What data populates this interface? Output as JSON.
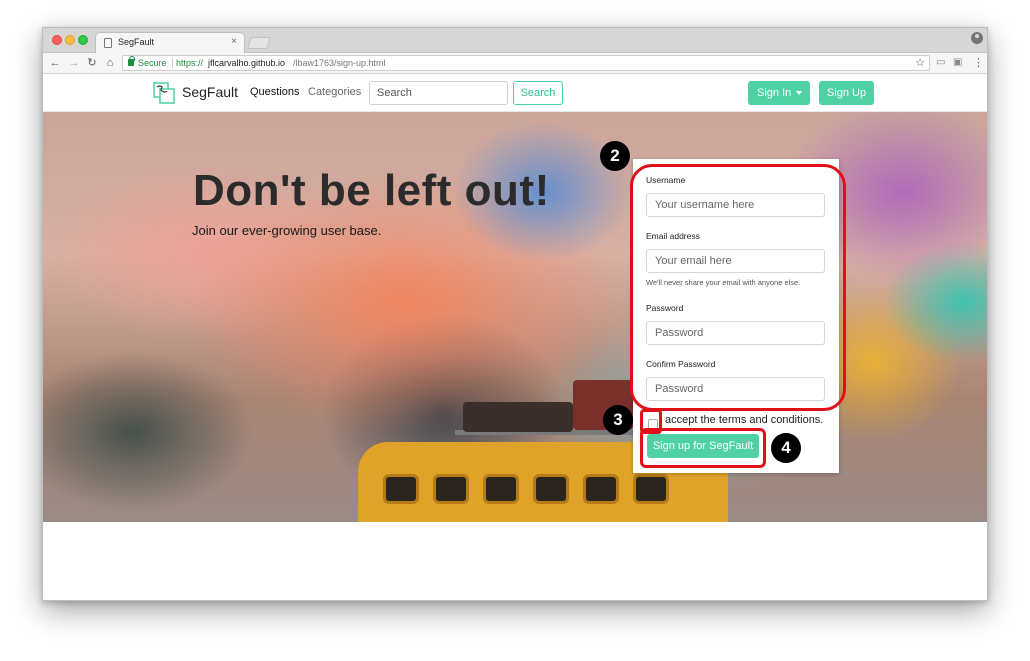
{
  "browser": {
    "tab_title": "SegFault",
    "tab_close": "×",
    "secure_label": "Secure",
    "url_scheme": "https://",
    "url_host": "jflcarvalho.github.io",
    "url_path": "/lbaw1763/sign-up.html",
    "back_glyph": "←",
    "forward_glyph": "→",
    "reload_glyph": "↻",
    "home_glyph": "⌂",
    "star_glyph": "☆",
    "menu_glyph": "⋮"
  },
  "navbar": {
    "brand": "SegFault",
    "links": {
      "questions": "Questions",
      "categories": "Categories"
    },
    "search_placeholder": "Search",
    "search_button": "Search",
    "signin_button": "Sign In",
    "signup_button": "Sign Up",
    "accent_color": "#4fd1a3"
  },
  "hero": {
    "title": "Don't be left out!",
    "subtitle": "Join our ever-growing user base."
  },
  "form": {
    "username_label": "Username",
    "username_placeholder": "Your username here",
    "email_label": "Email address",
    "email_placeholder": "Your email here",
    "email_help": "We'll never share your email with anyone else.",
    "password_label": "Password",
    "password_placeholder": "Password",
    "confirm_label": "Confirm Password",
    "confirm_placeholder": "Password",
    "terms_label": "accept the terms and conditions.",
    "submit_button": "Sign up for SegFault"
  },
  "annotations": {
    "form_step": "2",
    "checkbox_step": "3",
    "button_step": "4",
    "highlight_color": "#e0101a"
  }
}
